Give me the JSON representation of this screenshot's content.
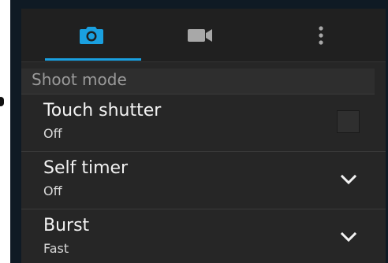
{
  "tabs": [
    {
      "icon": "camera-icon",
      "active": true
    },
    {
      "icon": "video-camera-icon",
      "active": false
    },
    {
      "icon": "more-vert-icon",
      "active": false
    }
  ],
  "colors": {
    "accent": "#1aa0e0",
    "background": "#262626",
    "text": "#f2f2f2",
    "subtext": "#d8d8d8",
    "section_header_text": "#9a9a9a"
  },
  "section": {
    "title": "Shoot mode"
  },
  "settings": [
    {
      "title": "Touch shutter",
      "value": "Off",
      "control": "checkbox",
      "checked": false
    },
    {
      "title": "Self timer",
      "value": "Off",
      "control": "dropdown"
    },
    {
      "title": "Burst",
      "value": "Fast",
      "control": "dropdown"
    }
  ]
}
